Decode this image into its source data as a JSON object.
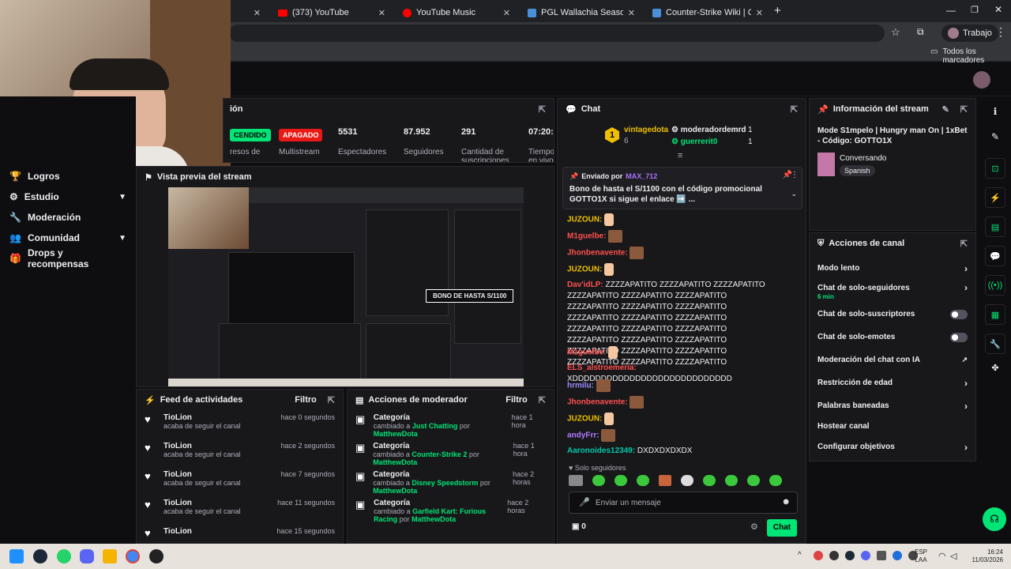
{
  "browser": {
    "tabs": [
      {
        "label": "(373) YouTube",
        "color": "#ff0000"
      },
      {
        "label": "YouTube Music",
        "color": "#ff0000"
      },
      {
        "label": "PGL Wallachia Season 7 - Liquip",
        "color": "#4a90d9"
      },
      {
        "label": "Counter-Strike Wiki | CS2 | Liqu",
        "color": "#4a90d9"
      }
    ],
    "profile_label": "Trabajo",
    "bookmarks_label": "Todos los marcadores"
  },
  "sidebar": {
    "items": [
      {
        "label": "Logros",
        "icon": "trophy-icon",
        "chevron": false
      },
      {
        "label": "Estudio",
        "icon": "gear-icon",
        "chevron": true
      },
      {
        "label": "Moderación",
        "icon": "wrench-icon",
        "chevron": false
      },
      {
        "label": "Comunidad",
        "icon": "people-icon",
        "chevron": true
      },
      {
        "label": "Drops y recompensas",
        "icon": "gift-icon",
        "chevron": false
      }
    ]
  },
  "stats_panel": {
    "title": "ión",
    "status_on": "CENDIDO",
    "status_off": "APAGADO",
    "ingresos_label": "resos de",
    "multistream_label": "Multistream",
    "stats": [
      {
        "value": "5531",
        "label": "Espectadores"
      },
      {
        "value": "87.952",
        "label": "Seguidores"
      },
      {
        "value": "291",
        "label": "Cantidad de suscripciones"
      },
      {
        "value": "07:20:5",
        "label": "Tiempo en vivo"
      }
    ]
  },
  "preview": {
    "title": "Vista previa del stream",
    "overlay_text": "BONO DE HASTA S/1100"
  },
  "activity_feed": {
    "title": "Feed de actividades",
    "filter": "Filtro",
    "items": [
      {
        "user": "TioLion",
        "text": "acaba de seguir el canal",
        "time": "hace 0 segundos"
      },
      {
        "user": "TioLion",
        "text": "acaba de seguir el canal",
        "time": "hace 2 segundos"
      },
      {
        "user": "TioLion",
        "text": "acaba de seguir el canal",
        "time": "hace 7 segundos"
      },
      {
        "user": "TioLion",
        "text": "acaba de seguir el canal",
        "time": "hace 11 segundos"
      },
      {
        "user": "TioLion",
        "text": "",
        "time": "hace 15 segundos"
      }
    ]
  },
  "mod_actions": {
    "title": "Acciones de moderador",
    "filter": "Filtro",
    "items": [
      {
        "title": "Categoría",
        "prefix": "cambiado a",
        "category": "Just Chatting",
        "by": "por",
        "mod": "MatthewDota",
        "time": "hace 1 hora"
      },
      {
        "title": "Categoría",
        "prefix": "cambiado a",
        "category": "Counter-Strike 2",
        "by": "por",
        "mod": "MatthewDota",
        "time": "hace 1 hora"
      },
      {
        "title": "Categoría",
        "prefix": "cambiado a",
        "category": "Disney Speedstorm",
        "by": "por",
        "mod": "MatthewDota",
        "time": "hace 2 horas"
      },
      {
        "title": "Categoría",
        "prefix": "cambiado a",
        "category": "Garfield Kart: Furious Racing",
        "by": "por",
        "mod": "MatthewDota",
        "time": "hace 2 horas"
      }
    ]
  },
  "chat": {
    "title": "Chat",
    "leaderboard": [
      {
        "rank": "1",
        "name": "vintagedota",
        "count": "6"
      },
      {
        "name": "moderadordemrd",
        "count": "1"
      },
      {
        "name": "guerrerit0",
        "count": "1"
      }
    ],
    "pinned": {
      "label": "Enviado por",
      "user": "MAX_712",
      "text": "Bono de hasta el S/1100 con el código promocional GOTTO1X si sigue el enlace ➡️ ..."
    },
    "messages": [
      {
        "user": "JUZOUN:",
        "color": "#f0c000",
        "text": ""
      },
      {
        "user": "M1guelbe:",
        "color": "#ff4f4f",
        "text": ""
      },
      {
        "user": "Jhonbenavente:",
        "color": "#ff4f4f",
        "text": ""
      },
      {
        "user": "JUZOUN:",
        "color": "#f0c000",
        "text": ""
      },
      {
        "user": "Dav'idLP:",
        "color": "#ff4f4f",
        "text": " ZZZZAPATITO ZZZZAPATITO ZZZZAPATITO ZZZZAPATITO ZZZZAPATITO ZZZZAPATITO ZZZZAPATITO ZZZZAPATITO ZZZZAPATITO ZZZZAPATITO ZZZZAPATITO ZZZZAPATITO ZZZZAPATITO ZZZZAPATITO ZZZZAPATITO ZZZZAPATITO ZZZZAPATITO ZZZZAPATITO ZZZZAPATITO ZZZZAPATITO ZZZZAPATITO ZZZZAPATITO ZZZZAPATITO ZZZZAPATITO"
      },
      {
        "user": "M1guelbe:",
        "color": "#ff4f4f",
        "text": ""
      },
      {
        "user": "ELS_alstroemeria:",
        "color": "#ff4f4f",
        "text": " XDDDDDDDDDDDDDDDDDDDDDDDDDDDD"
      },
      {
        "user": "hrmilu:",
        "color": "#9b8cff",
        "text": ""
      },
      {
        "user": "Jhonbenavente:",
        "color": "#ff4f4f",
        "text": ""
      },
      {
        "user": "JUZOUN:",
        "color": "#f0c000",
        "text": ""
      },
      {
        "user": "andyFrr:",
        "color": "#b07cff",
        "text": ""
      },
      {
        "user": "Aaronoides12349:",
        "color": "#00c8aa",
        "text": " DXDXDXDXDX"
      }
    ],
    "mode_label": "Solo seguidores",
    "input_placeholder": "Enviar un mensaje",
    "points": "0",
    "send_label": "Chat"
  },
  "stream_info": {
    "title": "Información del stream",
    "stream_title": "Mode S1mpelo | Hungry man On | 1xBet - Código: GOTTO1X",
    "category": "Conversando",
    "language": "Spanish"
  },
  "channel_actions": {
    "title": "Acciones de canal",
    "items": [
      {
        "label": "Modo lento",
        "control": "chevron",
        "sub": ""
      },
      {
        "label": "Chat de solo-seguidores",
        "control": "chevron",
        "sub": "6 min"
      },
      {
        "label": "Chat de solo-suscriptores",
        "control": "toggle",
        "sub": ""
      },
      {
        "label": "Chat de solo-emotes",
        "control": "toggle",
        "sub": ""
      },
      {
        "label": "Moderación del chat con IA",
        "control": "external",
        "sub": ""
      },
      {
        "label": "Restricción de edad",
        "control": "chevron",
        "sub": ""
      },
      {
        "label": "Palabras baneadas",
        "control": "chevron",
        "sub": ""
      },
      {
        "label": "Hostear canal",
        "control": "none",
        "sub": ""
      },
      {
        "label": "Configurar objetivos",
        "control": "chevron",
        "sub": ""
      }
    ]
  },
  "taskbar": {
    "lang": "ESP",
    "region": "LAA",
    "time": "16:24",
    "date": "11/03/2026"
  },
  "colors": {
    "accent": "#00e575",
    "status_on": "#00e575",
    "status_off": "#e91916"
  }
}
